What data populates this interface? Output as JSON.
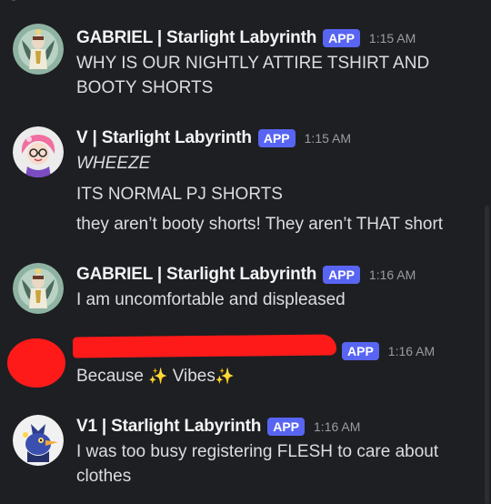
{
  "messages": [
    {
      "username": "GABRIEL | Starlight Labyrinth",
      "badge": "APP",
      "time": "1:15 AM",
      "lines": [
        "WHY IS OUR NIGHTLY ATTIRE TSHIRT AND",
        "BOOTY SHORTS"
      ],
      "avatar_icon": "angel-warrior-avatar-icon"
    },
    {
      "username": "V | Starlight Labyrinth",
      "badge": "APP",
      "time": "1:15 AM",
      "lines": [
        "WHEEZE",
        "ITS NORMAL PJ SHORTS",
        "they aren’t booty shorts! They aren’t THAT short"
      ],
      "avatar_icon": "pink-hair-girl-avatar-icon"
    },
    {
      "username": "GABRIEL | Starlight Labyrinth",
      "badge": "APP",
      "time": "1:16 AM",
      "lines": [
        "I am uncomfortable and displeased"
      ],
      "avatar_icon": "angel-warrior-avatar-icon"
    },
    {
      "username": "",
      "badge": "APP",
      "time": "1:16 AM",
      "lines": [
        "Because",
        "Vibes"
      ],
      "sparkle": "✨",
      "avatar_icon": "redacted-avatar-icon",
      "redacted": true,
      "redaction_color": "#ff1a1a"
    },
    {
      "username": "V1 | Starlight Labyrinth",
      "badge": "APP",
      "time": "1:16 AM",
      "lines": [
        "I was too busy registering FLESH to care about",
        "clothes"
      ],
      "avatar_icon": "robot-bird-avatar-icon"
    }
  ],
  "colors": {
    "background": "#1e1f22",
    "badge": "#5865f2",
    "username": "#f2f3f5",
    "text": "#dcdde1",
    "timestamp": "#9a9ca3",
    "sparkle": "#f6c244"
  }
}
